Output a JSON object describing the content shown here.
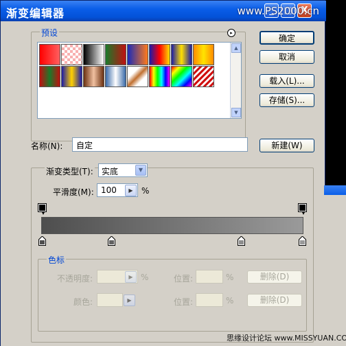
{
  "window": {
    "title": "渐变编辑器",
    "watermark": "www.PS2000.cn",
    "min_glyph": "_",
    "max_glyph": "□",
    "close_glyph": "X"
  },
  "presets": {
    "legend": "预设",
    "menu_glyph": "▸",
    "swatches": [
      "linear-gradient(to right, #ff0000, #ff6060)",
      "repeating-conic-gradient(#f8b0b0 0% 25%, #fff 0% 50%) 0 0/8px 8px",
      "linear-gradient(to right, #000, #fff)",
      "linear-gradient(to right, #1a7a2a, #c01010)",
      "linear-gradient(to right, #1b2bb8, #ff7a1a)",
      "linear-gradient(to right, #1a1aa8, #ff0000, #ffe000)",
      "linear-gradient(to right, #1a1aa8, #ffe000, #1a1aa8)",
      "linear-gradient(to right, #ff8a00, #ffe400, #ff8a00)",
      "linear-gradient(to right, #c01010, #1a7a2a, #c01010)",
      "linear-gradient(to right, #1a1aa8, #ffd000, #1a1aa8)",
      "linear-gradient(to right, #6a3010, #f0c0a0, #6a3010)",
      "linear-gradient(to right, #3a6aa8, #fff, #3a6aa8)",
      "linear-gradient(135deg, #fff 30%, #c07030 50%, #fff 70%)",
      "linear-gradient(to right, #ff0000, #ffff00, #00ff00, #00ffff, #0000ff, #ff00ff)",
      "linear-gradient(135deg, #ff0000, #ffff00, #00ff00, #00ffff, #0000ff, #ff00ff)",
      "repeating-linear-gradient(135deg, #d01010 0 3px, #fff 3px 6px)"
    ]
  },
  "buttons": {
    "ok": "确定",
    "cancel": "取消",
    "load": "载入(L)...",
    "save": "存储(S)...",
    "new": "新建(W)"
  },
  "name": {
    "label": "名称(N):",
    "value": "自定"
  },
  "gradient": {
    "type_label": "渐变类型(T):",
    "type_value": "实底",
    "smooth_label": "平滑度(M):",
    "smooth_value": "100",
    "smooth_unit": "%",
    "stop_color": "#000000",
    "start_color": "#4e4e4e",
    "end_color": "#9a9a9a"
  },
  "stops": {
    "legend": "色标",
    "opacity_label": "不透明度:",
    "opacity_unit": "%",
    "color_label": "颜色:",
    "location_label_1": "位置:",
    "location_unit_1": "%",
    "location_label_2": "位置:",
    "location_unit_2": "%",
    "delete_1": "删除(D)",
    "delete_2": "删除(D)"
  },
  "footer": {
    "text": "思缘设计论坛 www.MISSYUAN.COM"
  }
}
